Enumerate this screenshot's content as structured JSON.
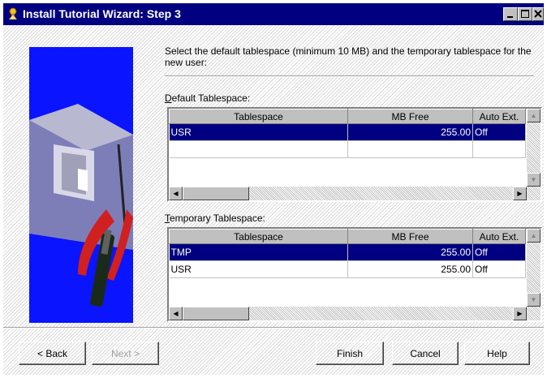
{
  "window": {
    "title": "Install Tutorial Wizard: Step 3"
  },
  "instructions": "Select the default tablespace (minimum 10 MB) and the temporary tablespace for the new user:",
  "default_group": {
    "label_underlined": "D",
    "label_rest": "efault Tablespace:",
    "columns": [
      "Tablespace",
      "MB Free",
      "Auto Ext."
    ],
    "rows": [
      {
        "tablespace": "USR",
        "mb_free": "255.00",
        "auto_ext": "Off",
        "selected": true
      }
    ]
  },
  "temporary_group": {
    "label_underlined": "T",
    "label_rest": "emporary Tablespace:",
    "columns": [
      "Tablespace",
      "MB Free",
      "Auto Ext."
    ],
    "rows": [
      {
        "tablespace": "TMP",
        "mb_free": "255.00",
        "auto_ext": "Off",
        "selected": true
      },
      {
        "tablespace": "USR",
        "mb_free": "255.00",
        "auto_ext": "Off",
        "selected": false
      }
    ]
  },
  "buttons": {
    "back": "< Back",
    "back_underline_index": 2,
    "next": "Next >",
    "finish": "Finish",
    "cancel": "Cancel",
    "help": "Help"
  },
  "icons": [
    "wizard-app-icon",
    "minimize-icon",
    "maximize-icon",
    "close-icon",
    "toolbox-illustration"
  ]
}
